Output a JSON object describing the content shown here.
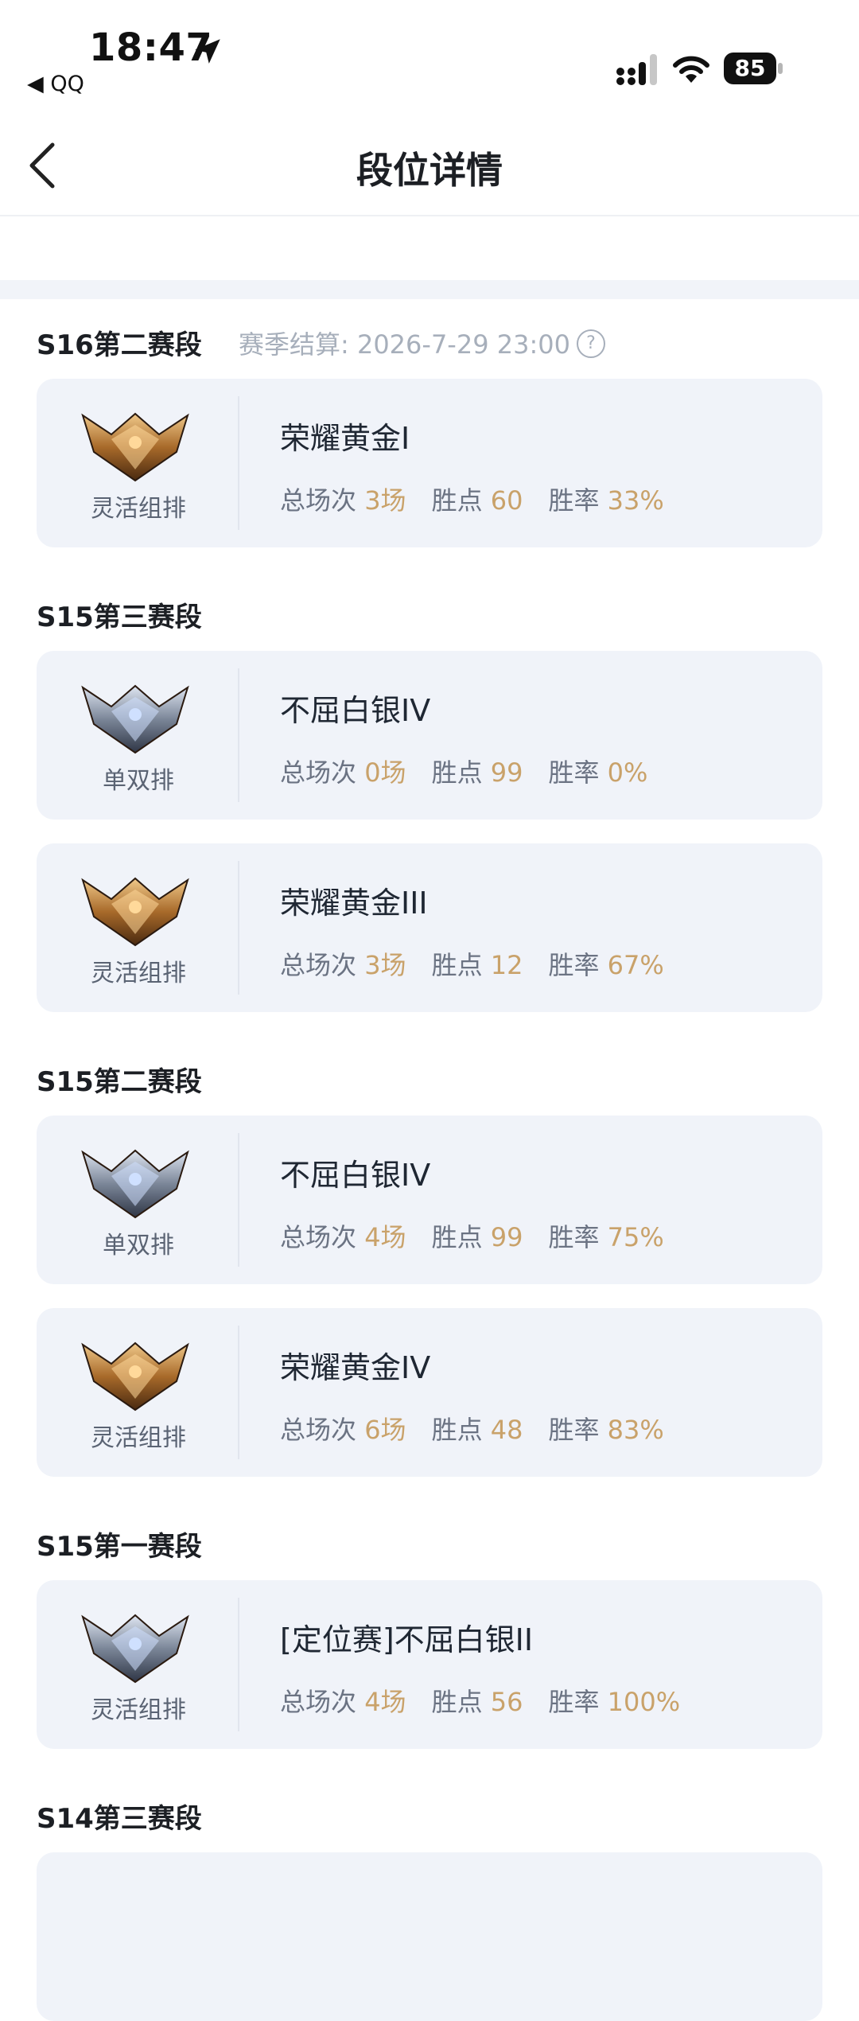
{
  "status_bar": {
    "time": "18:47",
    "back_app": "◀ QQ",
    "battery": "85",
    "icons": [
      "location-arrow-icon",
      "signal-icon",
      "wifi-icon",
      "battery-icon"
    ]
  },
  "nav": {
    "title": "段位详情",
    "back_icon": "chevron-left-icon"
  },
  "labels": {
    "total": "总场次",
    "points": "胜点",
    "winrate": "胜率"
  },
  "colors": {
    "accent": "#c9a26a",
    "card_bg": "#f0f3f9",
    "label": "#6b7383",
    "muted": "#a7afbb"
  },
  "seasons": [
    {
      "title": "S16第二赛段",
      "settle": "赛季结算: 2026-7-29 23:00",
      "records": [
        {
          "badge": "gold",
          "mode": "灵活组排",
          "rank": "荣耀黄金I",
          "games": "3场",
          "points": "60",
          "winrate": "33%"
        }
      ]
    },
    {
      "title": "S15第三赛段",
      "records": [
        {
          "badge": "silver",
          "mode": "单双排",
          "rank": "不屈白银IV",
          "games": "0场",
          "points": "99",
          "winrate": "0%"
        },
        {
          "badge": "gold",
          "mode": "灵活组排",
          "rank": "荣耀黄金III",
          "games": "3场",
          "points": "12",
          "winrate": "67%"
        }
      ]
    },
    {
      "title": "S15第二赛段",
      "records": [
        {
          "badge": "silver",
          "mode": "单双排",
          "rank": "不屈白银IV",
          "games": "4场",
          "points": "99",
          "winrate": "75%"
        },
        {
          "badge": "gold",
          "mode": "灵活组排",
          "rank": "荣耀黄金IV",
          "games": "6场",
          "points": "48",
          "winrate": "83%"
        }
      ]
    },
    {
      "title": "S15第一赛段",
      "records": [
        {
          "badge": "silver",
          "mode": "灵活组排",
          "rank": "[定位赛]不屈白银II",
          "games": "4场",
          "points": "56",
          "winrate": "100%"
        }
      ]
    },
    {
      "title": "S14第三赛段",
      "records": []
    }
  ]
}
